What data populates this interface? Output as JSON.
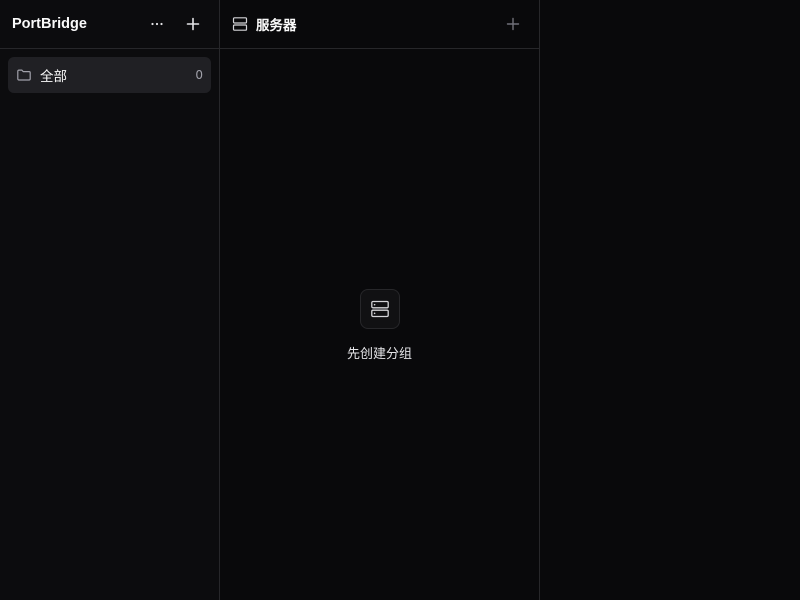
{
  "sidebar": {
    "app_title": "PortBridge",
    "more_icon": "ellipsis-icon",
    "add_icon": "plus-icon",
    "groups": [
      {
        "label": "全部",
        "count": "0",
        "icon": "folder-icon"
      }
    ]
  },
  "servers": {
    "title": "服务器",
    "title_icon": "server-icon",
    "add_icon": "plus-icon",
    "empty_state": {
      "icon": "server-icon",
      "message": "先创建分组"
    }
  },
  "colors": {
    "background": "#09090b",
    "sidebar_background": "#0c0c0e",
    "border": "#27272a",
    "selected_item": "#202024",
    "text": "#fafafa",
    "muted_text": "#a1a1aa"
  }
}
